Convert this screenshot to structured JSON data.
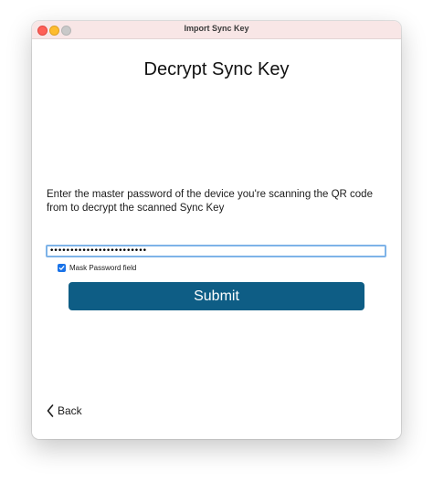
{
  "window": {
    "title": "Import Sync Key"
  },
  "main": {
    "heading": "Decrypt Sync Key",
    "instructions": "Enter the master password of the device you're scanning the QR code from to decrypt the scanned Sync Key",
    "password_value": "••••••••••••••••••••••••",
    "mask_checkbox": {
      "label": "Mask Password field",
      "checked": true
    },
    "submit_label": "Submit",
    "back_label": "Back"
  },
  "colors": {
    "accent": "#0e5d85",
    "checkbox": "#1a73e8",
    "focus_ring": "#7eb3e8",
    "titlebar": "#f8e6e6"
  },
  "icons": [
    "close-icon",
    "minimize-icon",
    "zoom-icon",
    "checkmark-icon",
    "chevron-left-icon"
  ]
}
